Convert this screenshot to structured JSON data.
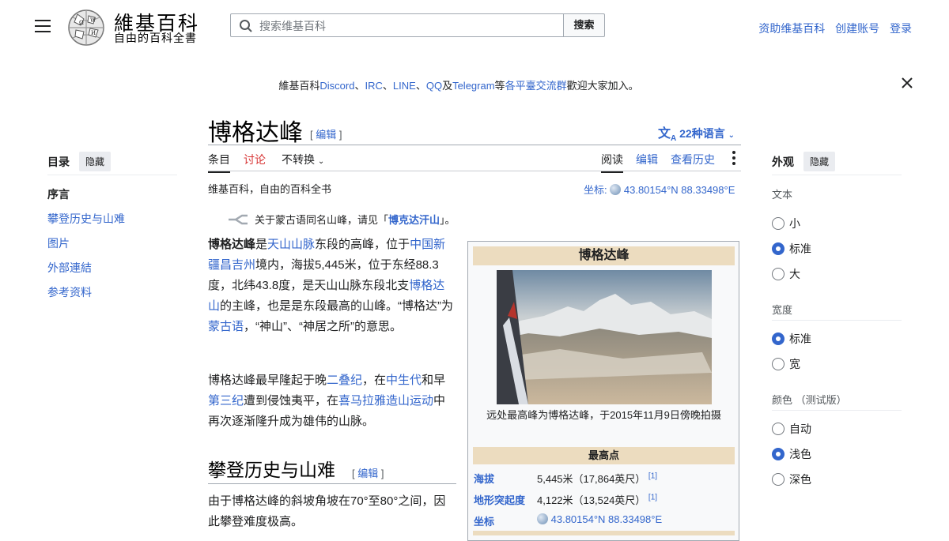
{
  "header": {
    "site_name": "維基百科",
    "site_tagline": "自由的百科全書",
    "search_placeholder": "搜索维基百科",
    "search_button": "搜索",
    "links": [
      "资助维基百科",
      "创建账号",
      "登录"
    ]
  },
  "banner": {
    "prefix": "維基百科",
    "items": [
      "Discord",
      "IRC",
      "LINE",
      "QQ",
      "Telegram"
    ],
    "sep1": "、",
    "sep2": "、",
    "sep3": "、",
    "and": "及",
    "deng": "等",
    "link": "各平臺交流群",
    "suffix": "歡迎大家加入。"
  },
  "toc": {
    "title": "目录",
    "hide": "隐藏",
    "items": [
      "序言",
      "攀登历史与山难",
      "图片",
      "外部連結",
      "参考资料"
    ]
  },
  "article": {
    "title": "博格达峰",
    "edit_label": "编辑",
    "languages": "22种语言",
    "tabs_left": [
      "条目",
      "讨论",
      "不转换"
    ],
    "tabs_right": [
      "阅读",
      "编辑",
      "查看历史"
    ],
    "tagline": "维基百科，自由的百科全书",
    "coord_label": "坐标",
    "coord_value": "43.80154°N 88.33498°E",
    "hatnote_pre": "关于蒙古语同名山峰，请见「",
    "hatnote_link": "博克达汗山",
    "hatnote_post": "」。",
    "section_h2": "攀登历史与山难",
    "section_text": "由于博格达峰的斜坡角坡在70°至80°之间，因此攀登难度极高。"
  },
  "infobox": {
    "title": "博格达峰",
    "caption": "远处最高峰为博格达峰，于2015年11月9日傍晚拍摄",
    "section": "最高点",
    "rows": [
      {
        "label": "海拔",
        "value": "5,445米（17,864英尺）",
        "ref": "[1]"
      },
      {
        "label": "地形突起度",
        "value": "4,122米（13,524英尺）",
        "ref": "[1]"
      },
      {
        "label": "坐标",
        "value": "43.80154°N 88.33498°E",
        "ref": ""
      }
    ]
  },
  "appearance": {
    "title": "外观",
    "hide": "隐藏",
    "text_label": "文本",
    "text_options": [
      "小",
      "标准",
      "大"
    ],
    "width_label": "宽度",
    "width_options": [
      "标准",
      "宽"
    ],
    "color_label": "颜色 （测试版）",
    "color_options": [
      "自动",
      "浅色",
      "深色"
    ]
  }
}
